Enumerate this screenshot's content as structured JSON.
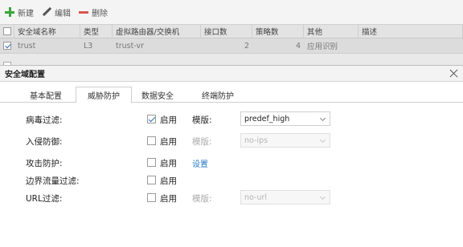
{
  "toolbar": {
    "new_label": "新建",
    "edit_label": "编辑",
    "delete_label": "删除"
  },
  "table": {
    "columns": [
      "安全域名称",
      "类型",
      "虚拟路由器/交换机",
      "接口数",
      "策略数",
      "其他",
      "描述"
    ],
    "rows": [
      {
        "checked": true,
        "cells": [
          "trust",
          "L3",
          "trust-vr",
          "2",
          "4",
          "应用识别",
          ""
        ]
      }
    ]
  },
  "modal": {
    "title": "安全域配置",
    "tabs": [
      "基本配置",
      "威胁防护",
      "数据安全",
      "终端防护"
    ],
    "active_tab": "威胁防护",
    "rows": {
      "antivirus": {
        "label": "病毒过滤:",
        "checked": true,
        "enable_label": "启用",
        "template_label": "模版:",
        "template_value": "predef_high",
        "disabled": false
      },
      "ips": {
        "label": "入侵防御:",
        "checked": false,
        "enable_label": "启用",
        "template_label": "模版:",
        "template_value": "no-ips",
        "disabled": true
      },
      "attack": {
        "label": "攻击防护:",
        "checked": false,
        "enable_label": "启用",
        "settings_link": "设置"
      },
      "border": {
        "label": "边界流量过滤:",
        "checked": false,
        "enable_label": "启用"
      },
      "url": {
        "label": "URL过滤:",
        "checked": false,
        "enable_label": "启用",
        "template_label": "模版:",
        "template_value": "no-url",
        "disabled": true
      }
    }
  },
  "colors": {
    "new_icon": "#3aa639",
    "delete_icon": "#d9534f",
    "link": "#2a7ac7",
    "check": "#2c6db5"
  }
}
